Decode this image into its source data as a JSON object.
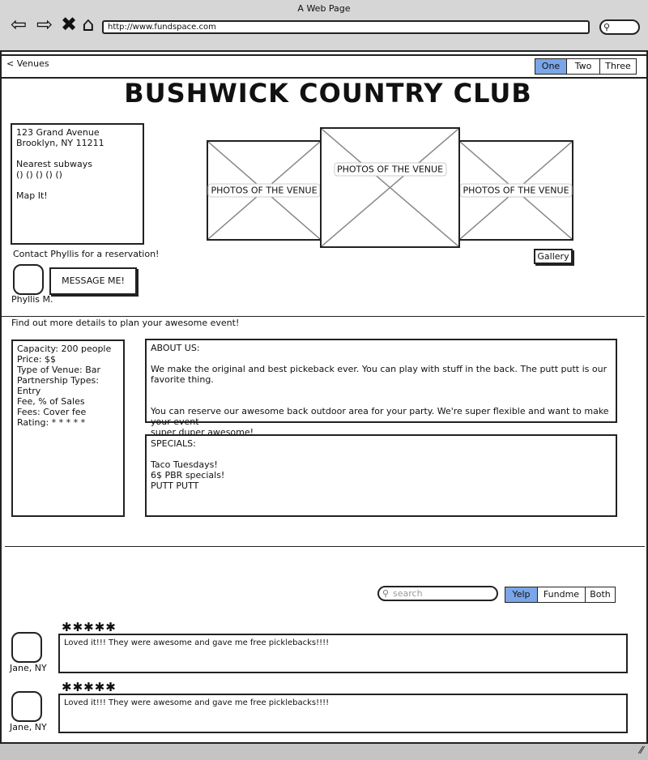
{
  "window": {
    "title": "A Web Page",
    "url": "http://www.fundspace.com"
  },
  "browser_icons": [
    "back-arrow-icon",
    "forward-arrow-icon",
    "close-x-icon",
    "home-icon",
    "search-icon"
  ],
  "topbar": {
    "back_label": "Venues",
    "tabs": [
      "One",
      "Two",
      "Three"
    ],
    "selected_tab": "One"
  },
  "venue": {
    "name": "BUSHWICK COUNTRY CLUB",
    "address_line1": "123 Grand Avenue",
    "address_line2": "Brooklyn, NY 11211",
    "subways_label": "Nearest subways",
    "subways_icons": "() () () () ()",
    "map_link": "Map It!",
    "contact_text": "Contact Phyllis for a reservation!",
    "message_button": "MESSAGE  ME!",
    "contact_name": "Phyllis M.",
    "photo_label": "PHOTOS OF THE VENUE",
    "gallery_button": "Gallery"
  },
  "details": {
    "heading": "Find out more details to plan your awesome event!",
    "capacity": "Capacity: 200 people",
    "price": "Price: $$",
    "type": "Type of Venue: Bar",
    "partnership_1": "Partnership Types: Entry",
    "partnership_2": "Fee, % of Sales",
    "fees": "Fees: Cover fee",
    "rating": "Rating: * * * * *"
  },
  "about": {
    "title": "ABOUT US:",
    "p1": "We make the original and best pickeback ever. You can play with stuff in the back. The putt putt is our favorite thing.",
    "p2_line1": "You can reserve our awesome back outdoor area for your party. We're super flexible and want to make your event",
    "p2_line2": "super duper awesome!"
  },
  "specials": {
    "title": "SPECIALS:",
    "items": [
      "Taco Tuesdays!",
      "6$ PBR specials!",
      "PUTT PUTT"
    ]
  },
  "reviews_filter": {
    "search_placeholder": "search",
    "tabs": [
      "Yelp",
      "Fundme",
      "Both"
    ],
    "selected": "Yelp"
  },
  "reviews": [
    {
      "stars": "✱✱✱✱✱",
      "text": "Loved it!!! They were awesome and gave me free picklebacks!!!!",
      "author": "Jane, NY"
    },
    {
      "stars": "✱✱✱✱✱",
      "text": "Loved it!!! They were awesome and gave me free picklebacks!!!!",
      "author": "Jane, NY"
    }
  ],
  "colors": {
    "accent": "#7aa6e8",
    "chrome": "#d6d6d6",
    "statusbar": "#c4c4c4"
  }
}
